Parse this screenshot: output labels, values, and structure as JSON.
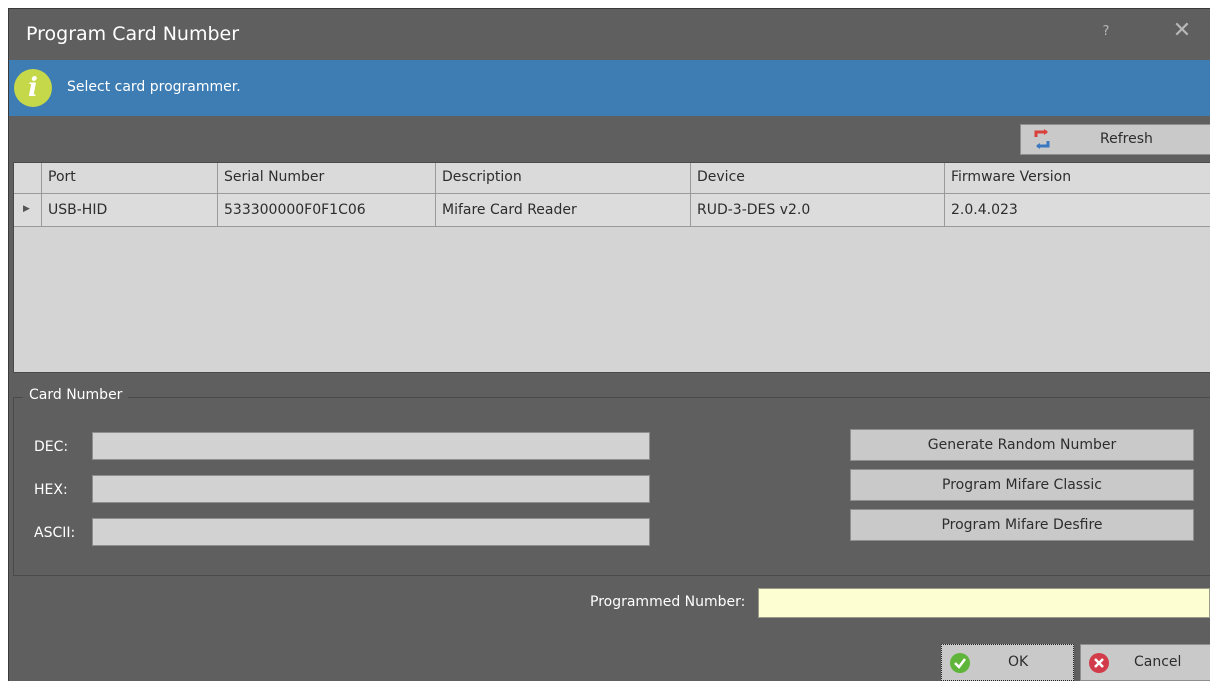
{
  "window": {
    "title": "Program Card Number",
    "help_glyph": "?",
    "close_glyph": "✕"
  },
  "info": {
    "icon": "info-icon",
    "glyph": "i",
    "message": "Select card programmer."
  },
  "toolbar": {
    "refresh_label": "Refresh",
    "refresh_icon": "refresh-icon"
  },
  "programmers": {
    "columns": [
      "Port",
      "Serial Number",
      "Description",
      "Device",
      "Firmware Version"
    ],
    "rows": [
      {
        "selected": true,
        "port": "USB-HID",
        "serial": "533300000F0F1C06",
        "description": "Mifare Card Reader",
        "device": "RUD-3-DES v2.0",
        "firmware": "2.0.4.023"
      }
    ]
  },
  "card_number": {
    "group_title": "Card Number",
    "dec_label": "DEC:",
    "hex_label": "HEX:",
    "ascii_label": "ASCII:",
    "dec_value": "",
    "hex_value": "",
    "ascii_value": "",
    "generate_label": "Generate Random Number",
    "program_classic_label": "Program Mifare Classic",
    "program_desfire_label": "Program Mifare Desfire"
  },
  "programmed": {
    "label": "Programmed Number:",
    "value": ""
  },
  "footer": {
    "ok_label": "OK",
    "cancel_label": "Cancel"
  },
  "colors": {
    "background": "#5f5f5f",
    "info_bar": "#3d7db4",
    "info_icon": "#c5d84a",
    "programmed_field": "#fefed3",
    "ok_icon": "#5fb43a",
    "cancel_icon": "#d23b4a"
  }
}
